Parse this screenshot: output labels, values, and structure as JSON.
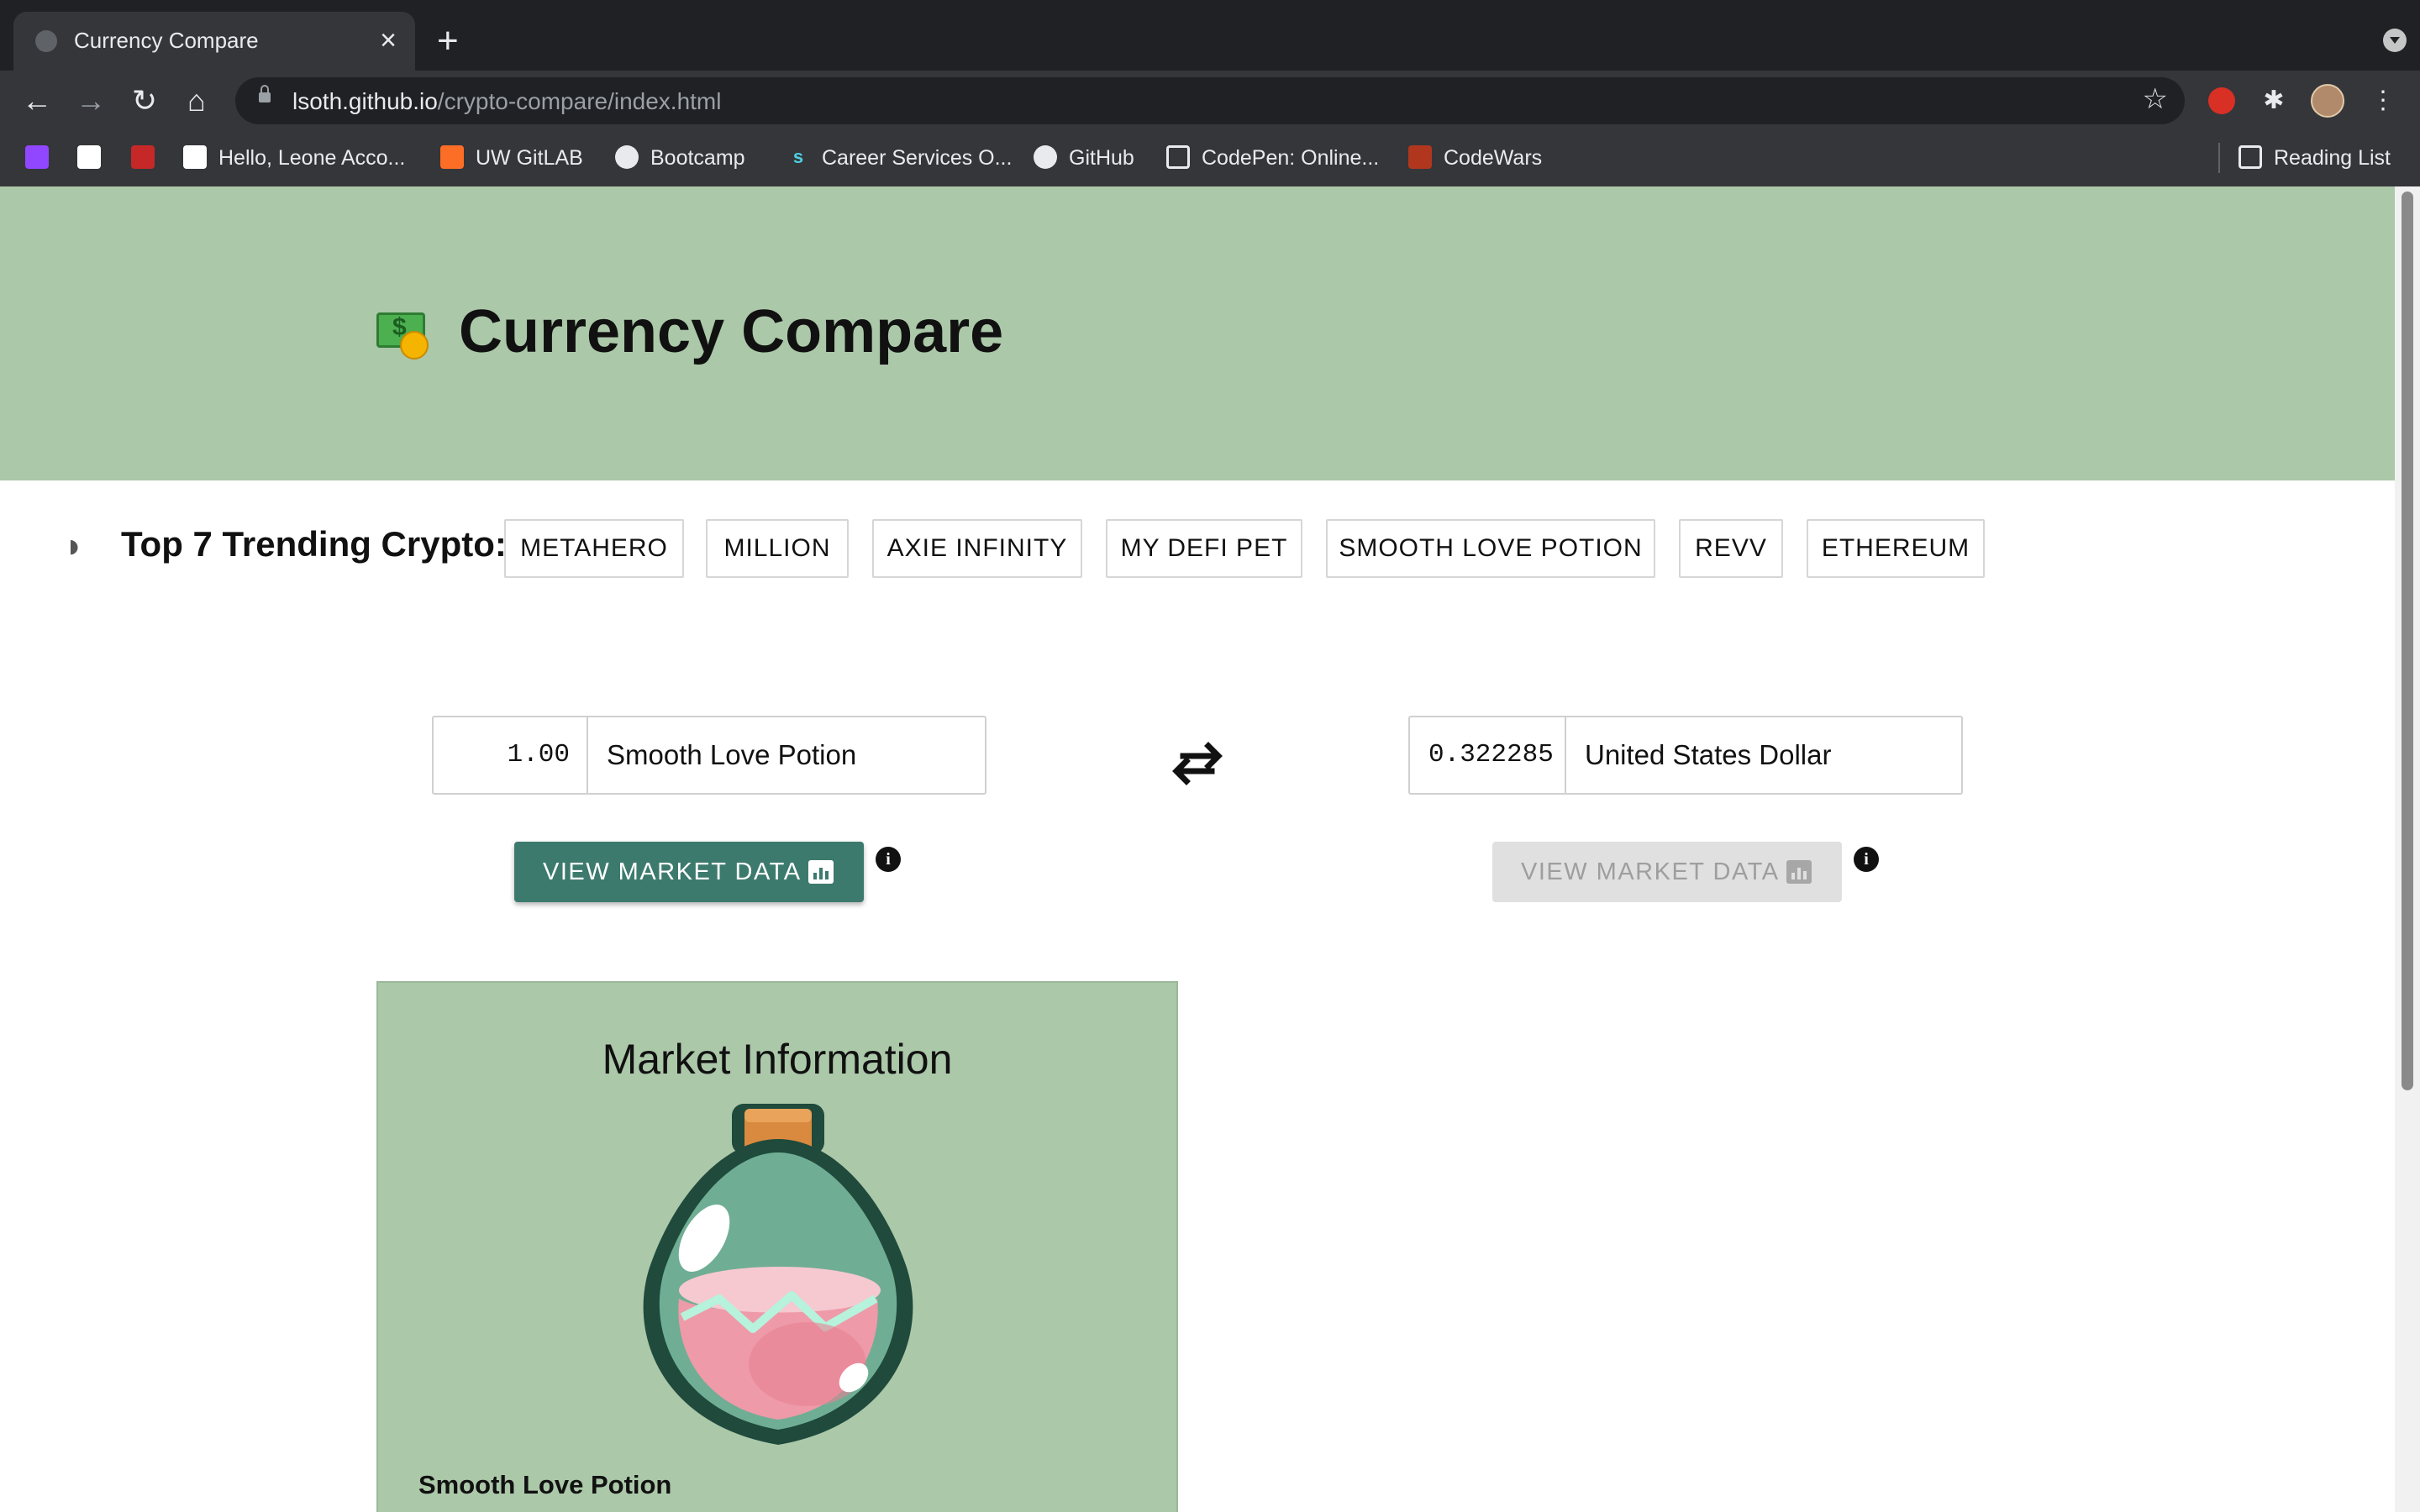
{
  "browser": {
    "tab_title": "Currency Compare",
    "url_host": "lsoth.github.io",
    "url_path": "/crypto-compare/index.html",
    "bookmarks": [
      "Hello, Leone Acco...",
      "UW GitLAB",
      "Bootcamp",
      "Career Services O...",
      "GitHub",
      "CodePen: Online...",
      "CodeWars"
    ],
    "reading_list": "Reading List"
  },
  "header": {
    "title": "Currency Compare"
  },
  "trending": {
    "label": "Top 7 Trending Crypto:",
    "items": [
      "METAHERO",
      "MILLION",
      "AXIE INFINITY",
      "MY DEFI PET",
      "SMOOTH LOVE POTION",
      "REVV",
      "ETHEREUM"
    ]
  },
  "converter": {
    "from_amount": "1.00",
    "from_currency": "Smooth Love Potion",
    "to_amount": "0.322285",
    "to_currency": "United States Dollar",
    "market_button_label": "VIEW MARKET DATA",
    "info_glyph": "i"
  },
  "market": {
    "title": "Market Information",
    "coin_name": "Smooth Love Potion"
  },
  "colors": {
    "hero_bg": "#abc8a9",
    "accent_button": "#3d7a6e",
    "disabled_button": "#e0e0e0"
  }
}
